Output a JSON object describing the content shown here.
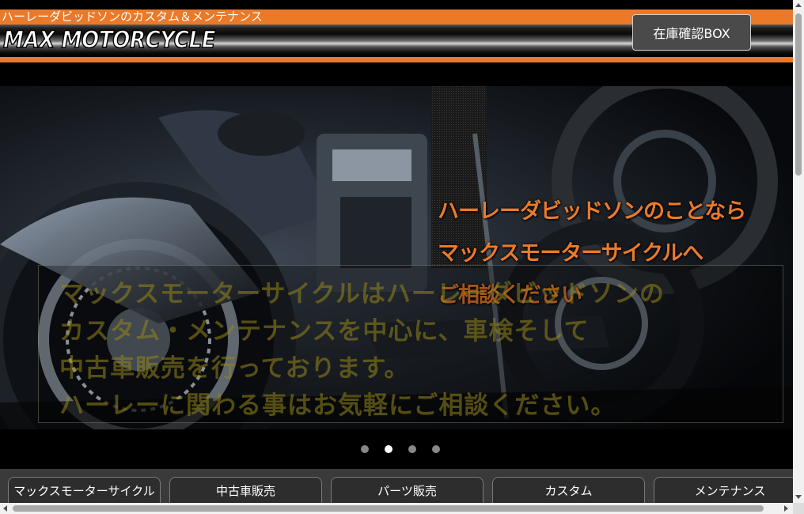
{
  "header": {
    "tagline": "ハーレーダビッドソンのカスタム＆メンテナンス",
    "logo_text": "MAX MOTORCYCLE",
    "stock_button_label": "在庫確認BOX"
  },
  "hero": {
    "title_lines": [
      "ハーレーダビッドソンのことなら",
      "マックスモーターサイクルへ",
      "ご相談ください"
    ],
    "message_lines": [
      "マックスモーターサイクルはハーレーダビッドソンの",
      "カスタム・メンテナンスを中心に、車検そして",
      "中古車販売を行っております。",
      "ハーレーに関わる事はお気軽にご相談ください。"
    ]
  },
  "slider": {
    "slide_count": 4,
    "active_index": 1
  },
  "nav": {
    "tabs": [
      "マックスモーターサイクル",
      "中古車販売",
      "パーツ販売",
      "カスタム",
      "メンテナンス"
    ]
  },
  "colors": {
    "accent": "#ea7a2a",
    "background": "#000000",
    "nav_bar": "#3a3a3a"
  }
}
